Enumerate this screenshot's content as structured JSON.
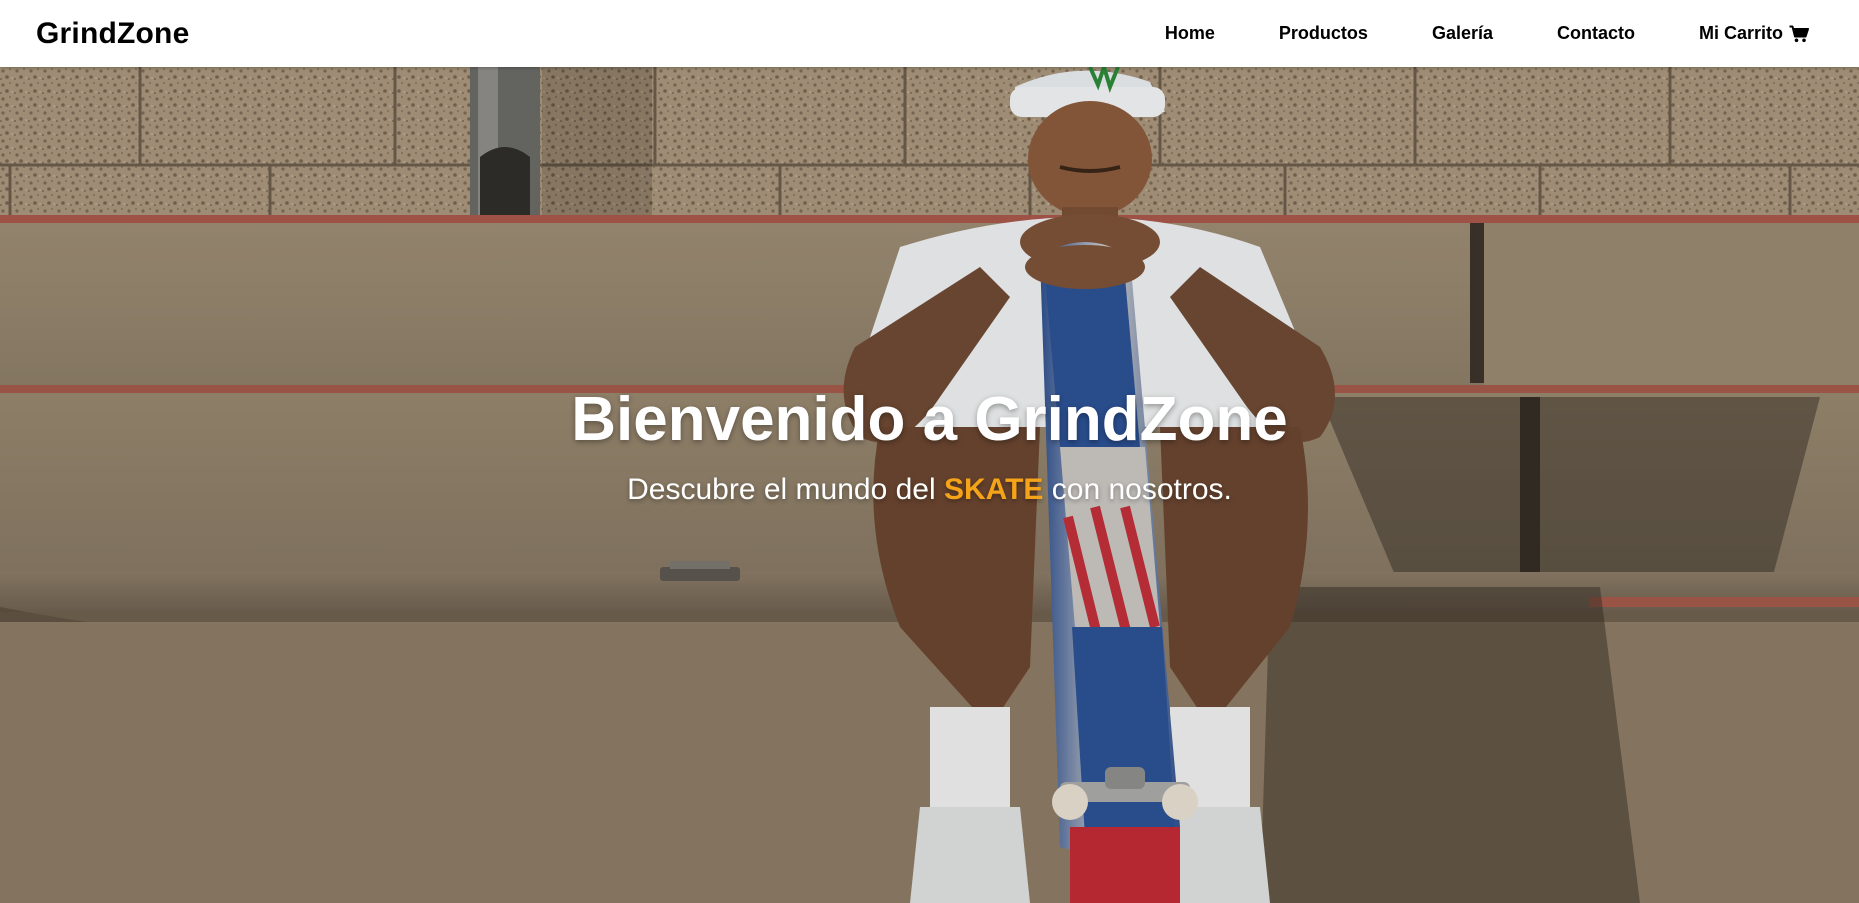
{
  "navbar": {
    "brand": "GrindZone",
    "links": [
      {
        "label": "Home"
      },
      {
        "label": "Productos"
      },
      {
        "label": "Galería"
      },
      {
        "label": "Contacto"
      },
      {
        "label": "Mi Carrito",
        "icon": "cart-icon"
      }
    ]
  },
  "hero": {
    "title": "Bienvenido a GrindZone",
    "subtitle_before": "Descubre el mundo del ",
    "subtitle_highlight": "SKATE",
    "subtitle_after": " con nosotros.",
    "highlight_color": "#f5a318",
    "background_image": "skateboarder sitting on concrete steps holding a skateboard"
  }
}
